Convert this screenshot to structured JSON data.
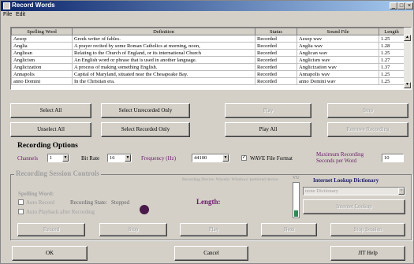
{
  "window": {
    "title": "Record Words",
    "controls": [
      "_",
      "□",
      "×"
    ]
  },
  "menu": [
    "File",
    "Edit"
  ],
  "table": {
    "columns": [
      "Spelling Word",
      "Definition",
      "Status",
      "Sound File",
      "Length"
    ],
    "rows": [
      [
        "Aesop",
        "Greek writer of fables.",
        "Recorded",
        "Aesop wav",
        "1.25"
      ],
      [
        "Anglia",
        "A prayer recited by some Roman Catholics at morning, noon,",
        "Recorded",
        "Anglia wav",
        "1.28"
      ],
      [
        "Angliean",
        "Relating to the Church of England, or its international Church",
        "Recorded",
        "Anglican wav",
        "1.25"
      ],
      [
        "Anglicism",
        "An English word or phrase that is used in another language.",
        "Recorded",
        "Anglicism wav",
        "1.27"
      ],
      [
        "Anglicization",
        "A process of making something English.",
        "Recorded",
        "Anglicization wav",
        "1.37"
      ],
      [
        "Annapolis",
        "Capital of Maryland, situated near the Chesapeake Bay.",
        "Recorded",
        "Annapolis wav",
        "1.25"
      ],
      [
        "anno Domini",
        "In the Christian era.",
        "Recorded",
        "anno Domini wav",
        "1.25"
      ]
    ]
  },
  "buttons": {
    "select_all": "Select All",
    "select_unrecorded": "Select Unrecorded Only",
    "play": "Play",
    "stop": "Stop",
    "unselect_all": "Unselect All",
    "select_recorded": "Select Recorded Only",
    "play_all": "Play All",
    "remove_recording": "Remove Recording"
  },
  "options": {
    "heading": "Recording Options",
    "channels_label": "Channels",
    "channels_value": "1",
    "bitrate_label": "Bit Rate",
    "bitrate_value": "16",
    "frequency_label": "Frequency (Hz)",
    "frequency_value": "44100",
    "wave_label": "WAVE File Format",
    "wave_checked": true,
    "max_label_1": "Maximum Recording",
    "max_label_2": "Seconds per Word",
    "max_value": "10"
  },
  "session": {
    "heading": "Recording Session Controls",
    "device": "Recording Device: WaveIn: Windows' preferred device",
    "spelling_word_label": "Spelling Word:",
    "auto_record": "Auto Record",
    "recording_state_label": "Recording State:",
    "recording_state_value": "Stopped",
    "auto_playback": "Auto Playback after Recording",
    "length_label": "Length:",
    "vu_label": "VU",
    "lookup_heading": "Internet Lookup Dictionary",
    "lookup_value": "none Dictionary",
    "lookup_button": "Internet Lookup",
    "record": "Record",
    "stop": "Stop",
    "play": "Play",
    "next": "Next",
    "stop_session": "Stop Session"
  },
  "footer": {
    "ok": "OK",
    "cancel": "Cancel",
    "help": "JIT Help"
  }
}
